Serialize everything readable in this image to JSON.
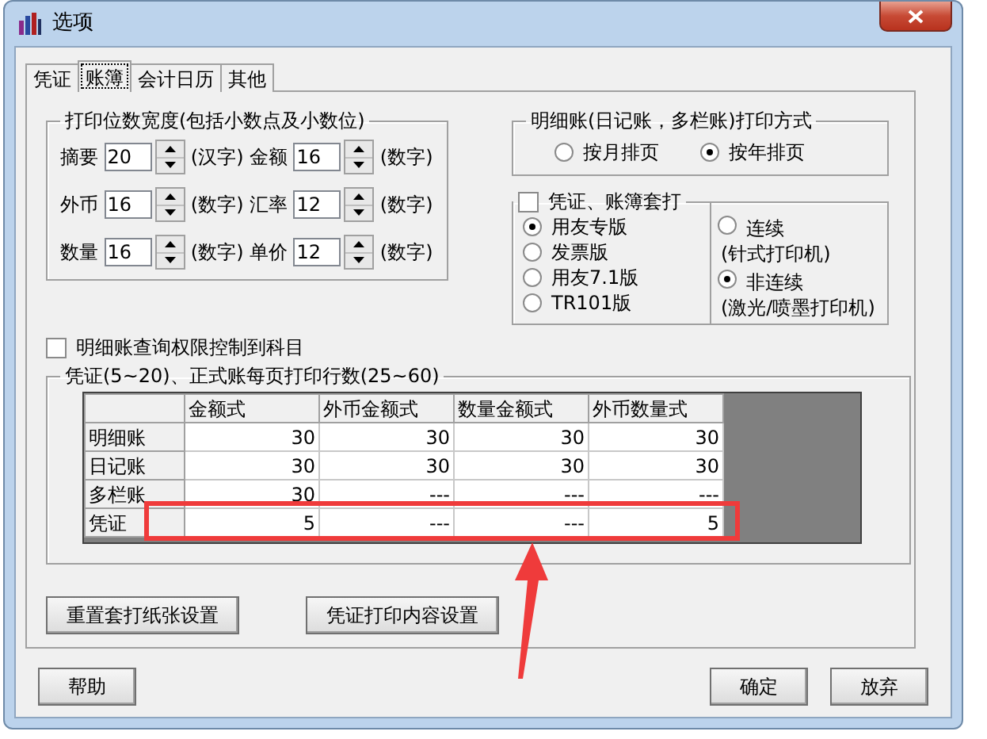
{
  "window": {
    "title": "选项"
  },
  "tabs": [
    {
      "label": "凭证",
      "selected": false
    },
    {
      "label": "账簿",
      "selected": true
    },
    {
      "label": "会计日历",
      "selected": false
    },
    {
      "label": "其他",
      "selected": false
    }
  ],
  "print_width": {
    "title": "打印位数宽度(包括小数点及小数位)",
    "fields": [
      {
        "label": "摘要",
        "value": "20",
        "unit": "(汉字)"
      },
      {
        "label": "金额",
        "value": "16",
        "unit": "(数字)"
      },
      {
        "label": "外币",
        "value": "16",
        "unit": "(数字)"
      },
      {
        "label": "汇率",
        "value": "12",
        "unit": "(数字)"
      },
      {
        "label": "数量",
        "value": "16",
        "unit": "(数字)"
      },
      {
        "label": "单价",
        "value": "12",
        "unit": "(数字)"
      }
    ]
  },
  "detail_print": {
    "title": "明细账(日记账，多栏账)打印方式",
    "options": [
      {
        "label": "按月排页",
        "selected": false
      },
      {
        "label": "按年排页",
        "selected": true
      }
    ]
  },
  "overprint": {
    "label": "凭证、账簿套打",
    "checked": false,
    "templates": [
      {
        "label": "用友专版",
        "selected": true
      },
      {
        "label": "发票版",
        "selected": false
      },
      {
        "label": "用友7.1版",
        "selected": false
      },
      {
        "label": "TR101版",
        "selected": false
      }
    ],
    "modes": [
      {
        "label": "连续",
        "note": "(针式打印机)",
        "selected": false
      },
      {
        "label": "非连续",
        "note": "(激光/喷墨打印机)",
        "selected": true
      }
    ]
  },
  "query_permission": {
    "label": "明细账查询权限控制到科目",
    "checked": false
  },
  "lines_per_page": {
    "title": "凭证(5~20)、正式账每页打印行数(25~60)",
    "columns": [
      "金额式",
      "外币金额式",
      "数量金额式",
      "外币数量式"
    ],
    "rows": [
      {
        "label": "明细账",
        "cells": [
          "30",
          "30",
          "30",
          "30"
        ],
        "highlighted": false
      },
      {
        "label": "日记账",
        "cells": [
          "30",
          "30",
          "30",
          "30"
        ],
        "highlighted": false
      },
      {
        "label": "多栏账",
        "cells": [
          "30",
          "---",
          "---",
          "---"
        ],
        "highlighted": false
      },
      {
        "label": "凭证",
        "cells": [
          "5",
          "---",
          "---",
          "5"
        ],
        "highlighted": true
      }
    ]
  },
  "actions": [
    "重置套打纸张设置",
    "凭证打印内容设置"
  ],
  "footer": {
    "left": [
      "帮助"
    ],
    "right": [
      "确定",
      "放弃"
    ]
  },
  "annotations": [
    {
      "kind": "arrow",
      "color": "#ef3b3b"
    }
  ]
}
